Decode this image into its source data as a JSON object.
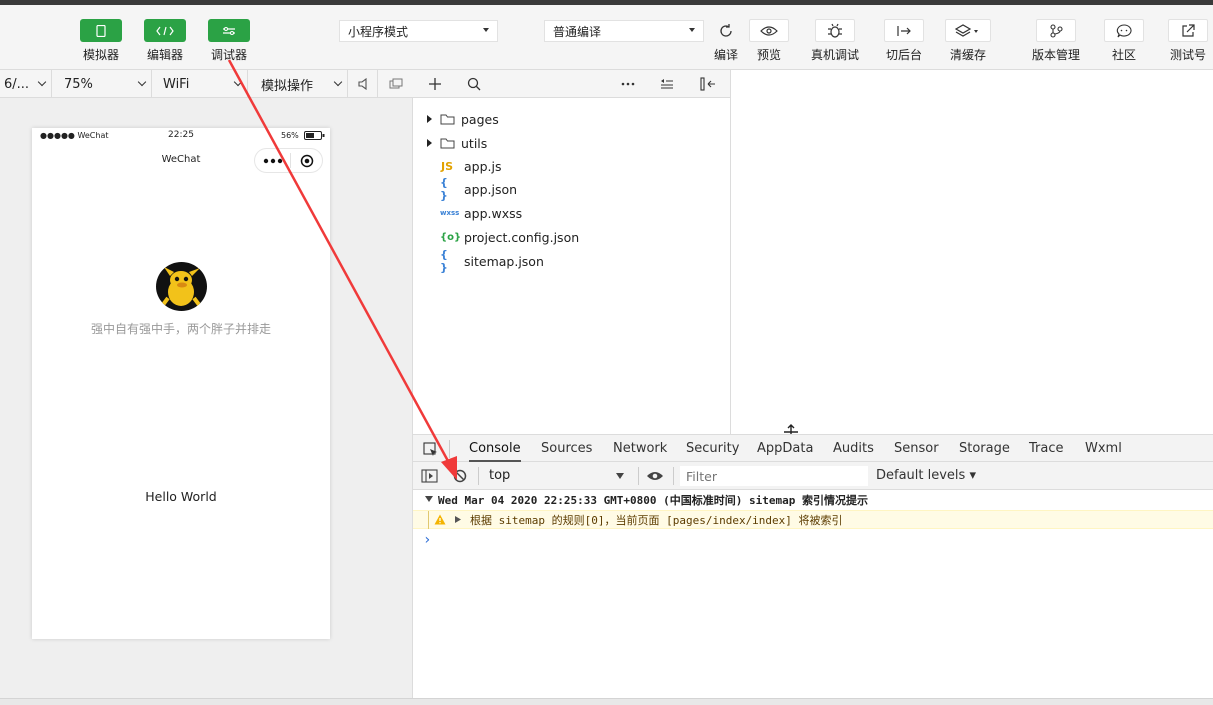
{
  "toolbar": {
    "simulator_label": "模拟器",
    "editor_label": "编辑器",
    "debugger_label": "调试器",
    "mode": "小程序模式",
    "compile_mode": "普通编译",
    "compile_label": "编译",
    "preview_label": "预览",
    "remote_debug_label": "真机调试",
    "background_label": "切后台",
    "clear_cache_label": "清缓存",
    "version_label": "版本管理",
    "community_label": "社区",
    "test_label": "测试号"
  },
  "simbar": {
    "device": "6/...",
    "zoom": "75%",
    "network": "WiFi",
    "action": "模拟操作"
  },
  "phone": {
    "carrier": "●●●●● WeChat",
    "time": "22:25",
    "battery": "56%",
    "nav_title": "WeChat",
    "motto": "强中自有强中手，两个胖子并排走",
    "hello": "Hello World"
  },
  "files": [
    {
      "name": "pages",
      "type": "folder"
    },
    {
      "name": "utils",
      "type": "folder"
    },
    {
      "name": "app.js",
      "type": "js"
    },
    {
      "name": "app.json",
      "type": "json"
    },
    {
      "name": "app.wxss",
      "type": "wxss"
    },
    {
      "name": "project.config.json",
      "type": "config"
    },
    {
      "name": "sitemap.json",
      "type": "json"
    }
  ],
  "devtools": {
    "tabs": [
      "Console",
      "Sources",
      "Network",
      "Security",
      "AppData",
      "Audits",
      "Sensor",
      "Storage",
      "Trace",
      "Wxml"
    ],
    "active_tab": "Console",
    "context": "top",
    "filter_placeholder": "Filter",
    "levels": "Default levels ▾",
    "log_header": "Wed Mar 04 2020 22:25:33 GMT+0800 (中国标准时间) sitemap 索引情况提示",
    "warn_text": "根据 sitemap 的规则[0]，当前页面 [pages/index/index] 将被索引",
    "prompt": "›"
  },
  "colors": {
    "accent_green": "#2ba245",
    "annotation_red": "#f03a3a",
    "warn_bg": "#fffbe5"
  }
}
